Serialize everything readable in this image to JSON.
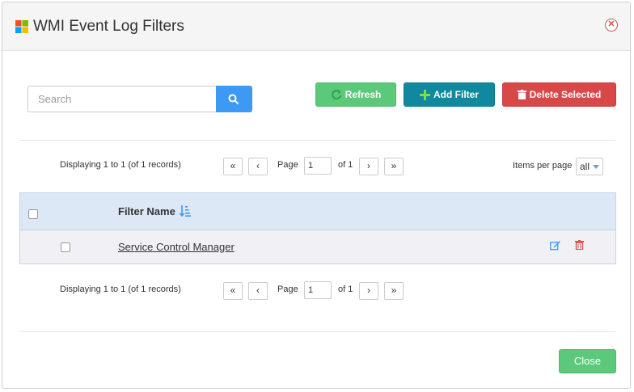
{
  "dialog": {
    "title": "WMI Event Log Filters",
    "logo_icon": "windows-logo-icon",
    "close_icon": "close-circle-icon"
  },
  "toolbar": {
    "search_placeholder": "Search",
    "search_value": "",
    "search_icon": "search-icon",
    "refresh_label": "Refresh",
    "add_filter_label": "Add Filter",
    "delete_selected_label": "Delete Selected"
  },
  "pager_top": {
    "display_text": "Displaying 1 to 1 (of 1 records)",
    "page_label": "Page",
    "page_value": "1",
    "of_text": "of 1",
    "items_per_page_label": "Items per page",
    "items_per_page_value": "all"
  },
  "table": {
    "columns": [
      {
        "label": "Filter Name",
        "sortable": true
      }
    ],
    "rows": [
      {
        "name": "Service Control Manager"
      }
    ]
  },
  "pager_bottom": {
    "display_text": "Displaying 1 to 1 (of 1 records)",
    "page_label": "Page",
    "page_value": "1",
    "of_text": "of 1"
  },
  "footer": {
    "close_label": "Close"
  },
  "colors": {
    "refresh": "#5cc97a",
    "add_filter": "#10899f",
    "delete": "#d94848",
    "search_button": "#3c9af5",
    "header_row": "#dce8f5"
  }
}
